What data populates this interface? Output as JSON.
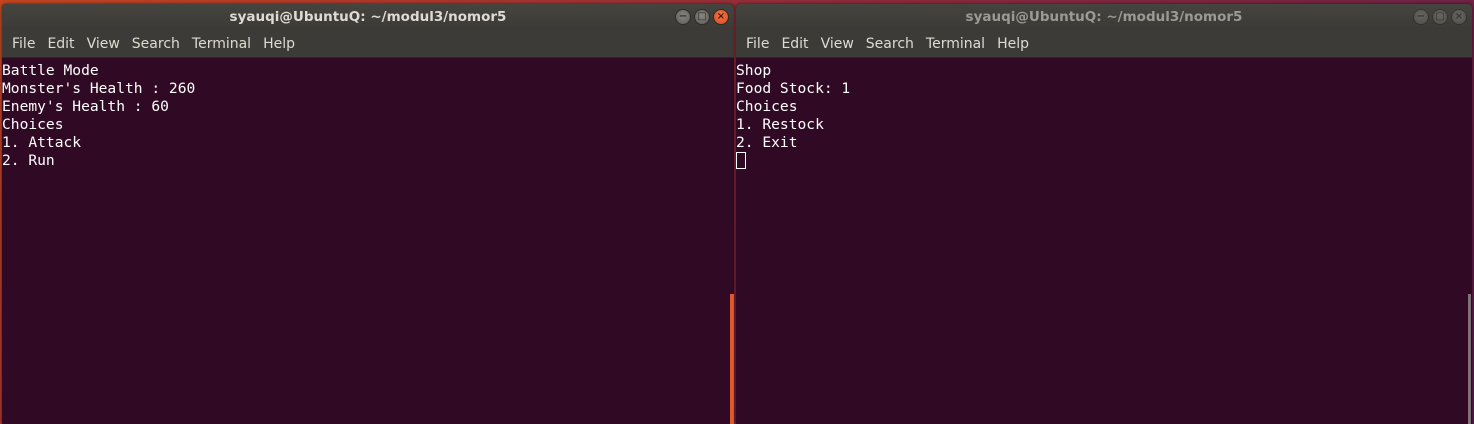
{
  "windows": {
    "left": {
      "title": "syauqi@UbuntuQ: ~/modul3/nomor5",
      "menu": [
        "File",
        "Edit",
        "View",
        "Search",
        "Terminal",
        "Help"
      ],
      "lines": [
        "Battle Mode",
        "Monster's Health : 260",
        "Enemy's Health : 60",
        "Choices",
        "1. Attack",
        "2. Run"
      ]
    },
    "right": {
      "title": "syauqi@UbuntuQ: ~/modul3/nomor5",
      "menu": [
        "File",
        "Edit",
        "View",
        "Search",
        "Terminal",
        "Help"
      ],
      "lines": [
        "Shop",
        "Food Stock: 1",
        "Choices",
        "1. Restock",
        "2. Exit"
      ]
    }
  },
  "controls": {
    "minimize": "−",
    "maximize": "□",
    "close": "×"
  },
  "colors": {
    "terminal_bg": "#300a24",
    "titlebar_bg": "#3c3b37",
    "close_button": "#e0592a"
  }
}
